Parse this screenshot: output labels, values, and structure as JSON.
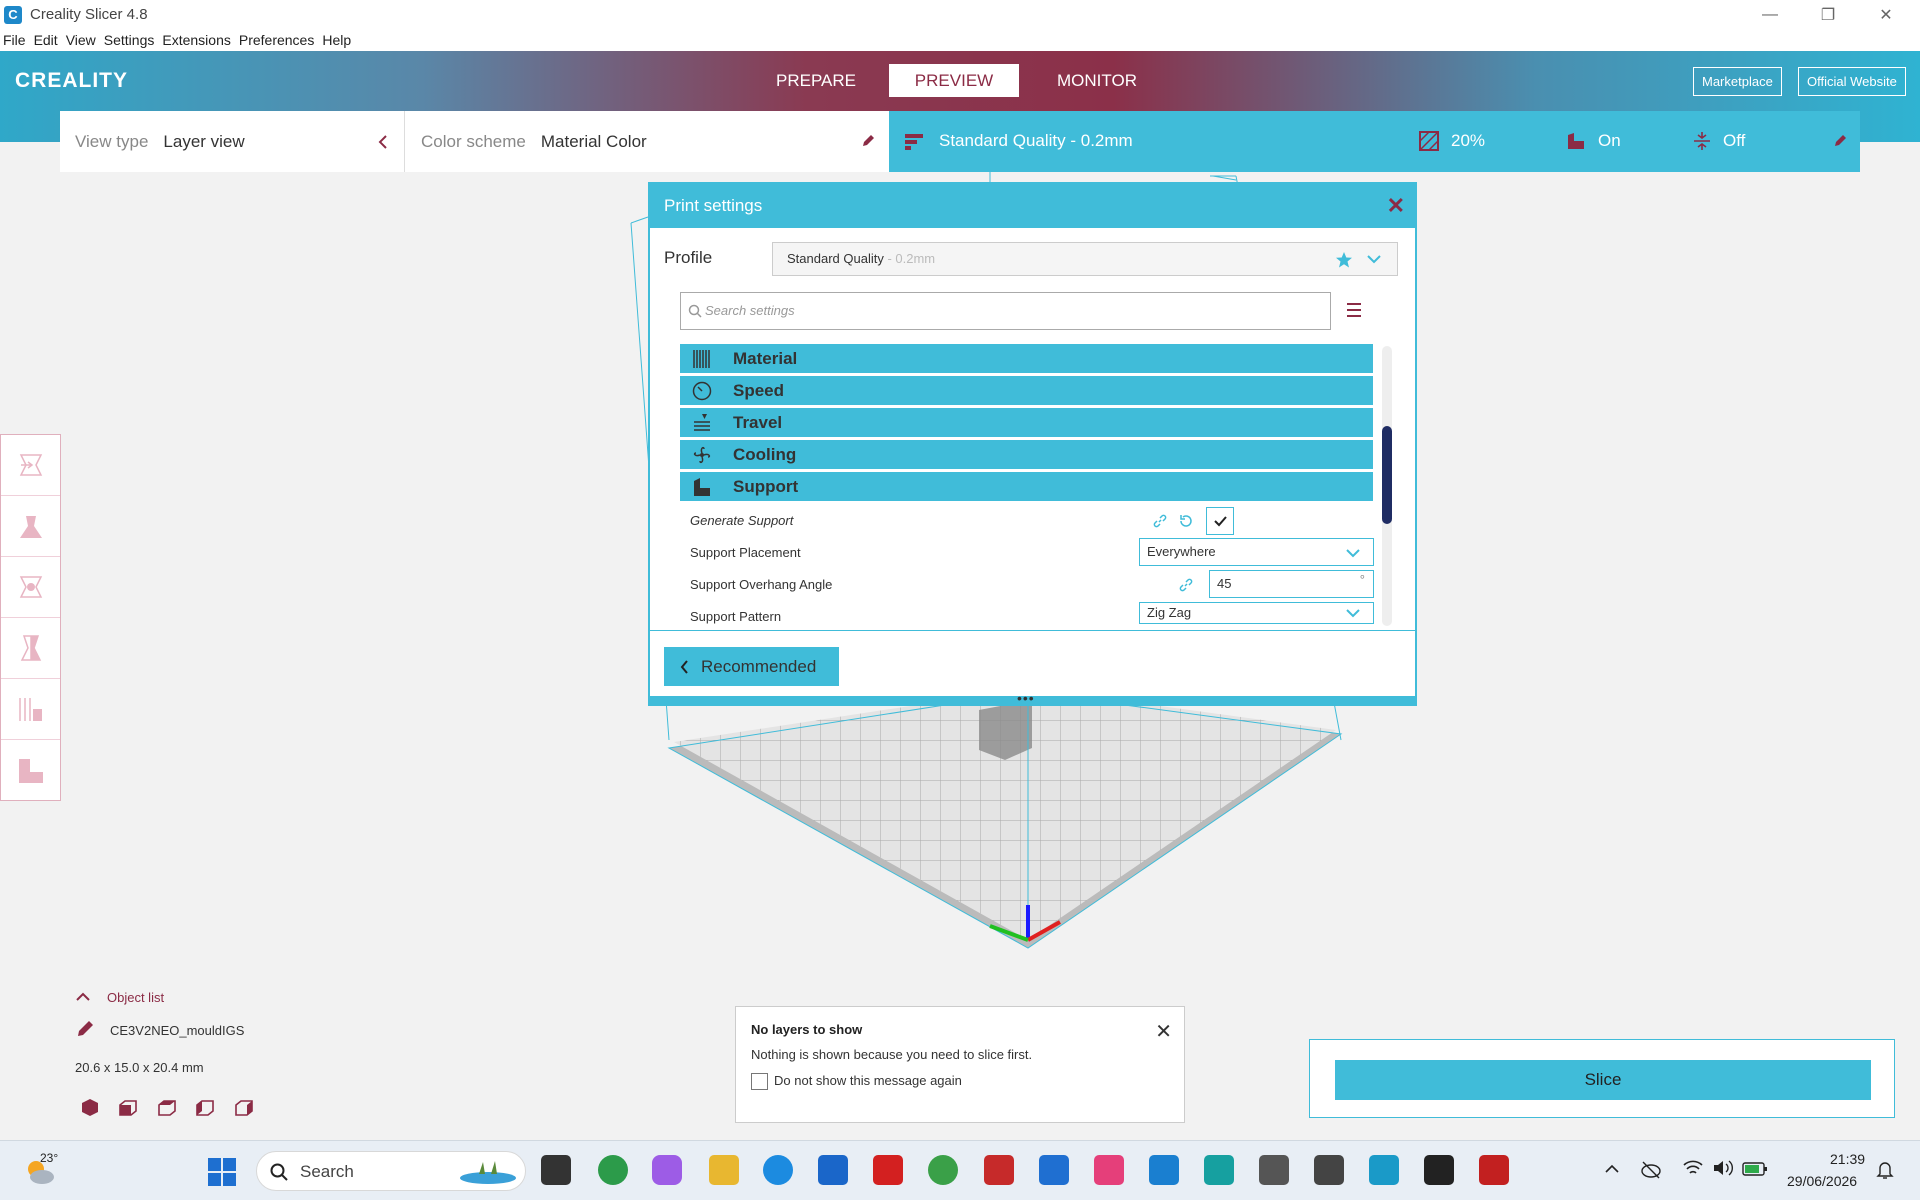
{
  "window": {
    "title": "Creality Slicer 4.8"
  },
  "menu": [
    "File",
    "Edit",
    "View",
    "Settings",
    "Extensions",
    "Preferences",
    "Help"
  ],
  "header": {
    "logo": "CREALITY",
    "tabs": [
      "PREPARE",
      "PREVIEW",
      "MONITOR"
    ],
    "active_tab": "PREVIEW",
    "marketplace": "Marketplace",
    "official_website": "Official Website"
  },
  "viewbar": {
    "view_type_label": "View type",
    "view_type_value": "Layer view",
    "color_scheme_label": "Color scheme",
    "color_scheme_value": "Material Color"
  },
  "quality": {
    "profile": "Standard Quality - 0.2mm",
    "infill": "20%",
    "support": "On",
    "adhesion": "Off"
  },
  "print_settings": {
    "title": "Print settings",
    "profile_label": "Profile",
    "profile_name": "Standard Quality",
    "profile_suffix": " - 0.2mm",
    "search_placeholder": "Search settings",
    "categories": [
      "Material",
      "Speed",
      "Travel",
      "Cooling",
      "Support"
    ],
    "settings": {
      "generate_support": "Generate Support",
      "support_placement": "Support Placement",
      "support_placement_value": "Everywhere",
      "overhang_angle": "Support Overhang Angle",
      "overhang_angle_value": "45",
      "overhang_unit": "°",
      "support_pattern": "Support Pattern",
      "support_pattern_value": "Zig Zag"
    },
    "recommended": "Recommended"
  },
  "object_list": {
    "title": "Object list",
    "object_name": "CE3V2NEO_mouldIGS",
    "dimensions": "20.6 x 15.0 x 20.4 mm"
  },
  "message": {
    "title": "No layers to show",
    "body": "Nothing is shown because you need to slice first.",
    "checkbox": "Do not show this message again"
  },
  "slice": {
    "label": "Slice"
  },
  "taskbar": {
    "weather": "23°",
    "search": "Search",
    "time": "21:39",
    "date": "29/06/2026"
  },
  "colors": {
    "accent": "#40bcd9",
    "brand": "#8b2b45",
    "dark": "#1f2c63"
  }
}
